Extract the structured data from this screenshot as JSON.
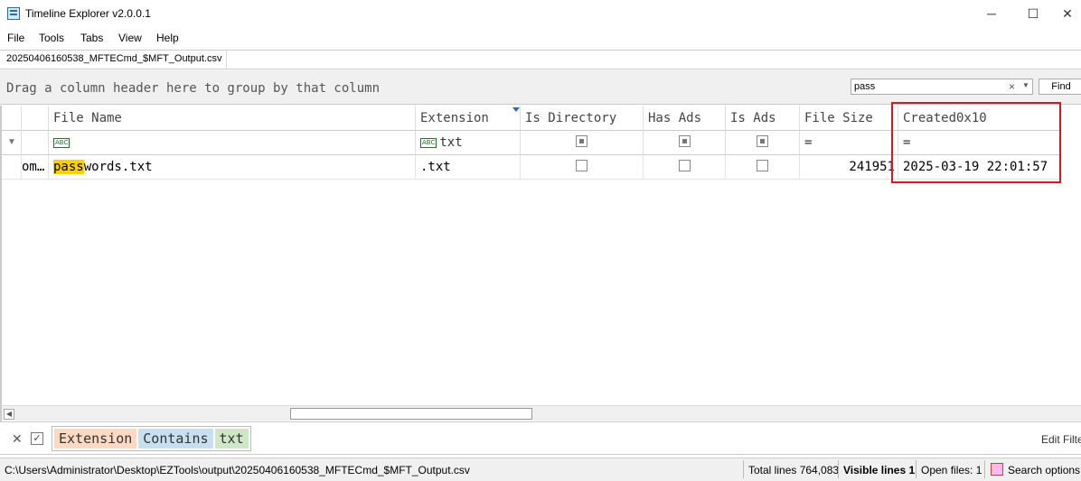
{
  "window": {
    "title": "Timeline Explorer v2.0.0.1",
    "minimize_glyph": "─",
    "maximize_glyph": "☐",
    "close_glyph": "✕"
  },
  "menu": [
    "File",
    "Tools",
    "Tabs",
    "View",
    "Help"
  ],
  "tab": {
    "label": "20250406160538_MFTECmd_$MFT_Output.csv"
  },
  "group_panel": {
    "hint": "Drag a column header here to group by that column"
  },
  "search": {
    "value": "pass",
    "clear_glyph": "×",
    "dropdown_glyph": "▼",
    "find_label": "Find"
  },
  "grid": {
    "columns": [
      "File Name",
      "Extension",
      "Is Directory",
      "Has Ads",
      "Is Ads",
      "File Size",
      "Created0x10"
    ],
    "filter_row": {
      "file_name": "",
      "extension": "txt",
      "file_size": "=",
      "created": "="
    },
    "rows": [
      {
        "prefix": "om…",
        "file_name_highlight": "pass",
        "file_name_rest": "words.txt",
        "extension": ".txt",
        "is_directory": false,
        "has_ads": false,
        "is_ads": false,
        "file_size": "241951",
        "created": "2025-03-19 22:01:57"
      }
    ]
  },
  "filter_bar": {
    "tokens": [
      {
        "text": "Extension",
        "color": "#fbd9c2"
      },
      {
        "text": "Contains",
        "color": "#c8dff0"
      },
      {
        "text": "txt",
        "color": "#cfe6c8"
      }
    ],
    "edit_label": "Edit Filter"
  },
  "status": {
    "path": "C:\\Users\\Administrator\\Desktop\\EZTools\\output\\20250406160538_MFTECmd_$MFT_Output.csv",
    "total_lines": "Total lines 764,083",
    "visible_lines": "Visible lines 1",
    "open_files": "Open files: 1",
    "search_options": "Search options"
  },
  "colors": {
    "highlight": "#ffd000",
    "annotation": "#e0141e"
  },
  "icons": [
    "app-icon",
    "filter-funnel-icon",
    "abc-filter-icon",
    "close-icon",
    "checkbox-icon",
    "search-options-icon"
  ]
}
